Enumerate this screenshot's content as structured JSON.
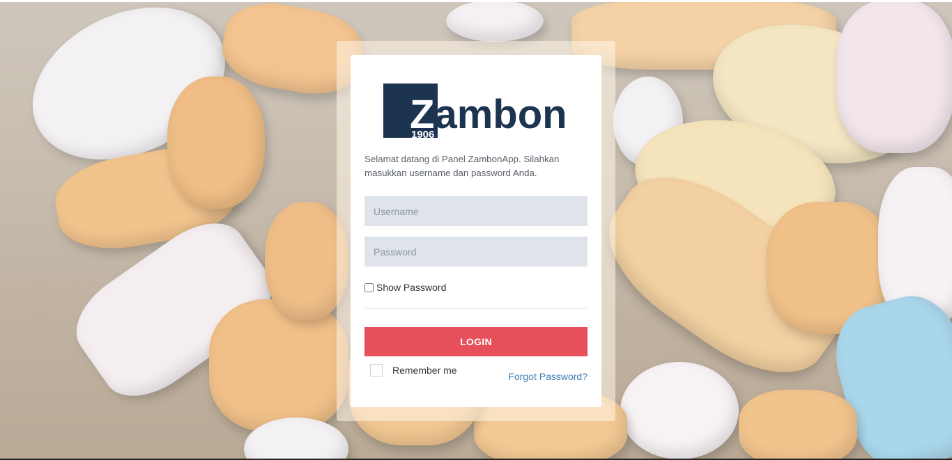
{
  "brand": {
    "logo_text": "Zambon",
    "logo_year": "1906",
    "logo_color": "#1c3450"
  },
  "login": {
    "intro_text": "Selamat datang di Panel ZambonApp. Silahkan masukkan username dan password Anda.",
    "username_placeholder": "Username",
    "password_placeholder": "Password",
    "show_password_label": "Show Password",
    "login_button_label": "LOGIN",
    "remember_label": "Remember me",
    "forgot_label": "Forgot Password?",
    "accent_color": "#e7505a",
    "link_color": "#3d7fb6"
  }
}
